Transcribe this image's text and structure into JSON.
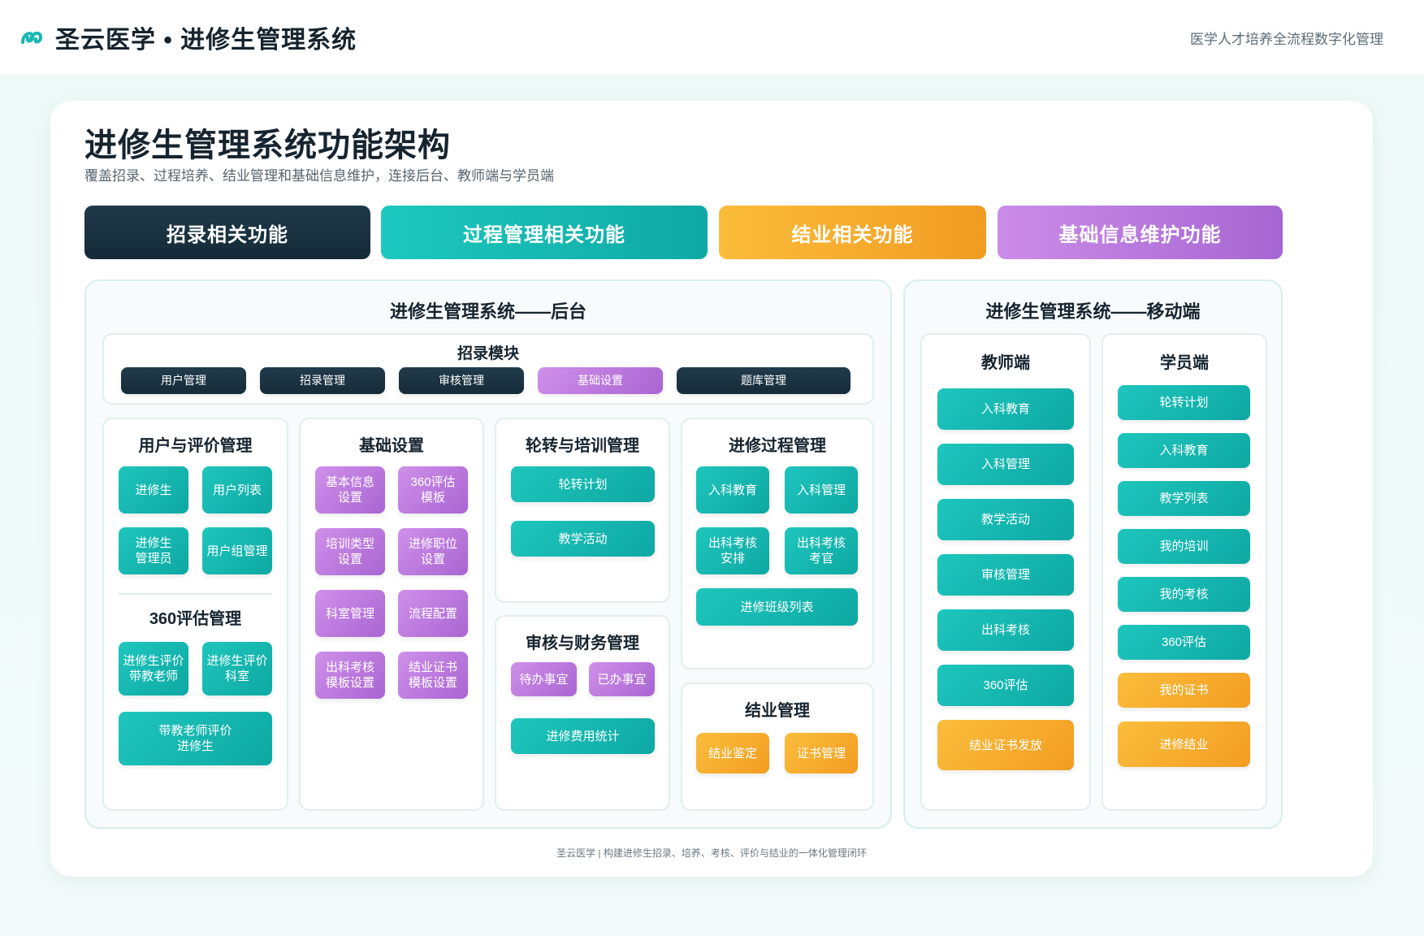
{
  "header": {
    "brand_title": "圣云医学 • 进修生管理系统",
    "slogan": "医学人才培养全流程数字化管理",
    "logo_icon": "sy-logo-icon"
  },
  "main": {
    "title": "进修生管理系统功能架构",
    "subtitle": "覆盖招录、过程培养、结业管理和基础信息维护，连接后台、教师端与学员端"
  },
  "categories": [
    {
      "label": "招录相关功能",
      "color": "#1b3442"
    },
    {
      "label": "过程管理相关功能",
      "color": "#14b8b1"
    },
    {
      "label": "结业相关功能",
      "color": "#f5aa2b"
    },
    {
      "label": "基础信息维护功能",
      "color": "#b777dc"
    }
  ],
  "backend": {
    "title": "进修生管理系统——后台",
    "recruit": {
      "title": "招录模块",
      "items": [
        "用户管理",
        "招录管理",
        "审核管理",
        "基础设置",
        "题库管理"
      ]
    },
    "user_eval": {
      "title": "用户与评价管理",
      "items": [
        "进修生",
        "用户列表",
        "进修生\n管理员",
        "用户组管理"
      ],
      "eval_title": "360评估管理",
      "eval_items": [
        "进修生评价\n带教老师",
        "进修生评价\n科室",
        "带教老师评价\n进修生"
      ]
    },
    "basic": {
      "title": "基础设置",
      "items": [
        "基本信息\n设置",
        "360评估\n模板",
        "培训类型\n设置",
        "进修职位\n设置",
        "科室管理",
        "流程配置",
        "出科考核\n模板设置",
        "结业证书\n模板设置"
      ]
    },
    "rotation": {
      "title": "轮转与培训管理",
      "items": [
        "轮转计划",
        "教学活动"
      ]
    },
    "audit": {
      "title": "审核与财务管理",
      "items": [
        "待办事宜",
        "已办事宜",
        "进修费用统计"
      ]
    },
    "process": {
      "title": "进修过程管理",
      "items": [
        "入科教育",
        "入科管理",
        "出科考核\n安排",
        "出科考核\n考官",
        "进修班级列表"
      ]
    },
    "graduation": {
      "title": "结业管理",
      "items": [
        "结业鉴定",
        "证书管理"
      ]
    }
  },
  "mobile": {
    "title": "进修生管理系统——移动端",
    "teacher": {
      "title": "教师端",
      "items": [
        "入科教育",
        "入科管理",
        "教学活动",
        "审核管理",
        "出科考核",
        "360评估",
        "结业证书发放"
      ]
    },
    "student": {
      "title": "学员端",
      "items": [
        "轮转计划",
        "入科教育",
        "教学列表",
        "我的培训",
        "我的考核",
        "360评估",
        "我的证书",
        "进修结业"
      ]
    }
  },
  "footer": "圣云医学 | 构建进修生招录、培养、考核、评价与结业的一体化管理闭环"
}
